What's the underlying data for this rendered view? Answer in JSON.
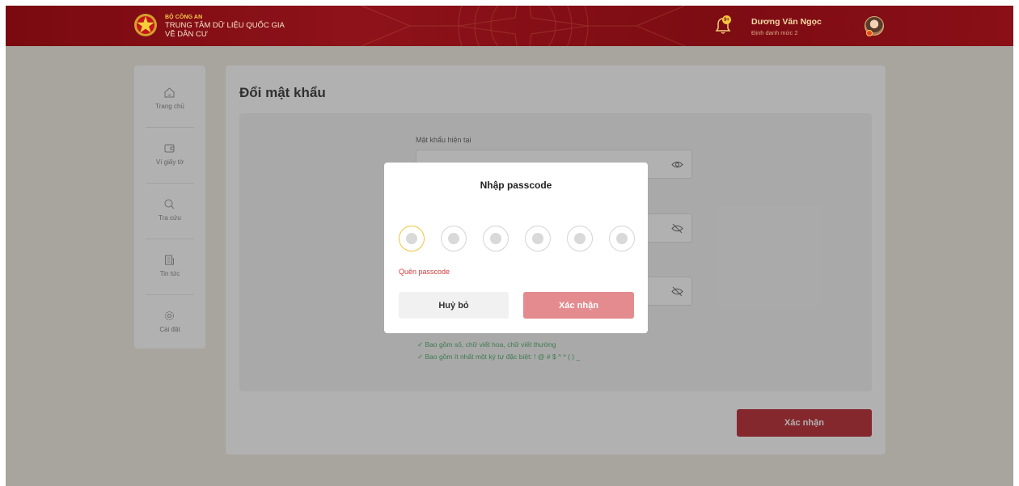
{
  "header": {
    "org_line1": "BỘ CÔNG AN",
    "org_line2": "TRUNG TÂM DỮ LIỆU QUỐC GIA",
    "org_line3": "VỀ DÂN CƯ",
    "notification_badge": "9+",
    "user_name": "Dương Văn Ngọc",
    "user_role": "Định danh mức 2"
  },
  "sidebar": {
    "items": [
      {
        "label": "Trang chủ",
        "icon": "home-icon"
      },
      {
        "label": "Ví giấy tờ",
        "icon": "wallet-icon"
      },
      {
        "label": "Tra cứu",
        "icon": "search-icon"
      },
      {
        "label": "Tin tức",
        "icon": "news-icon"
      },
      {
        "label": "Cài đặt",
        "icon": "settings-icon"
      }
    ]
  },
  "main": {
    "title": "Đổi mật khẩu",
    "current_password_label": "Mật khẩu hiện tại",
    "hints": [
      "✓ Bao gồm số, chữ viết hoa, chữ viết thường",
      "✓ Bao gồm ít nhất một ký tự đặc biệt: ! @ # $ ^ * ( ) _"
    ],
    "submit_label": "Xác nhận"
  },
  "modal": {
    "title": "Nhập passcode",
    "digits_total": 6,
    "digits_filled": 0,
    "forgot_label": "Quên passcode",
    "cancel_label": "Huỷ bỏ",
    "confirm_label": "Xác nhận"
  },
  "colors": {
    "brand_red": "#b3141d",
    "header_red": "#8e121a",
    "confirm_disabled": "#e48b8f",
    "hint_green": "#3aa35a",
    "active_pin": "#f0c63a"
  }
}
